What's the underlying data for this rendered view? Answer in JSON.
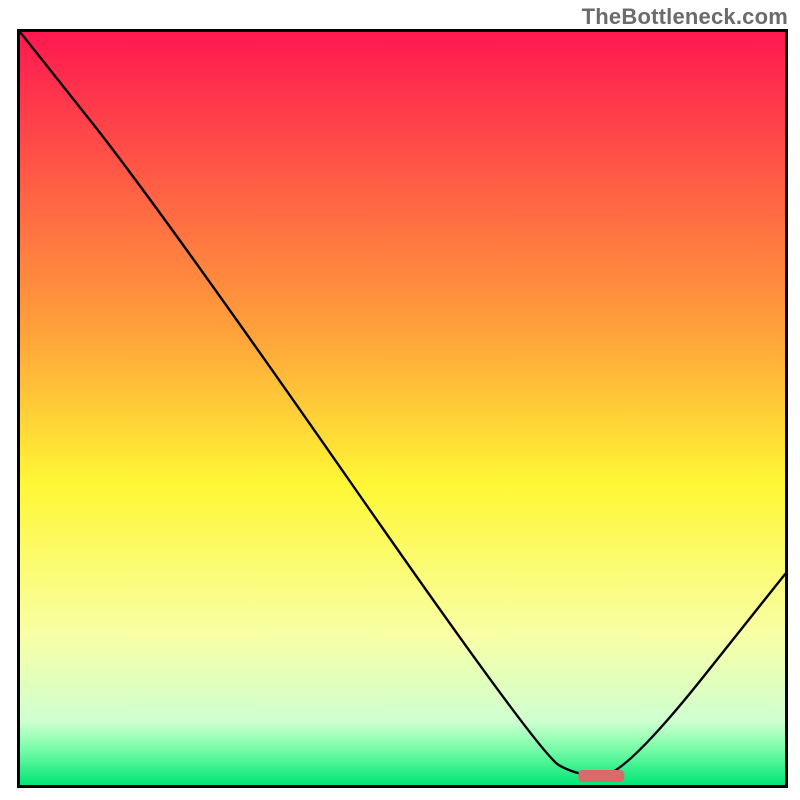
{
  "watermark": "TheBottleneck.com",
  "chart_data": {
    "type": "line",
    "title": "",
    "xlabel": "",
    "ylabel": "",
    "xlim": [
      0,
      100
    ],
    "ylim": [
      0,
      100
    ],
    "grid": false,
    "legend": false,
    "background_gradient": {
      "top": "#ff1850",
      "mid_top": "#ffa23a",
      "mid": "#fff735",
      "mid_low": "#f8ffa5",
      "low_band": "#cfffd0",
      "bottom": "#00e676"
    },
    "stops": [
      {
        "offset": 0.0,
        "color": "#ff1850"
      },
      {
        "offset": 0.4,
        "color": "#ffa23a"
      },
      {
        "offset": 0.6,
        "color": "#fff735"
      },
      {
        "offset": 0.8,
        "color": "#f8ffa5"
      },
      {
        "offset": 0.915,
        "color": "#cfffd0"
      },
      {
        "offset": 0.945,
        "color": "#8affb0"
      },
      {
        "offset": 1.0,
        "color": "#00e676"
      }
    ],
    "series": [
      {
        "name": "bottleneck-curve",
        "x": [
          0,
          18,
          68,
          73,
          79,
          100
        ],
        "y": [
          100,
          77,
          4,
          1.2,
          1.2,
          28
        ]
      }
    ],
    "marker": {
      "name": "optimal-band",
      "x_start": 73,
      "x_end": 79,
      "y_center": 1.2,
      "color": "#d86a6a",
      "shape": "rounded-bar"
    }
  }
}
